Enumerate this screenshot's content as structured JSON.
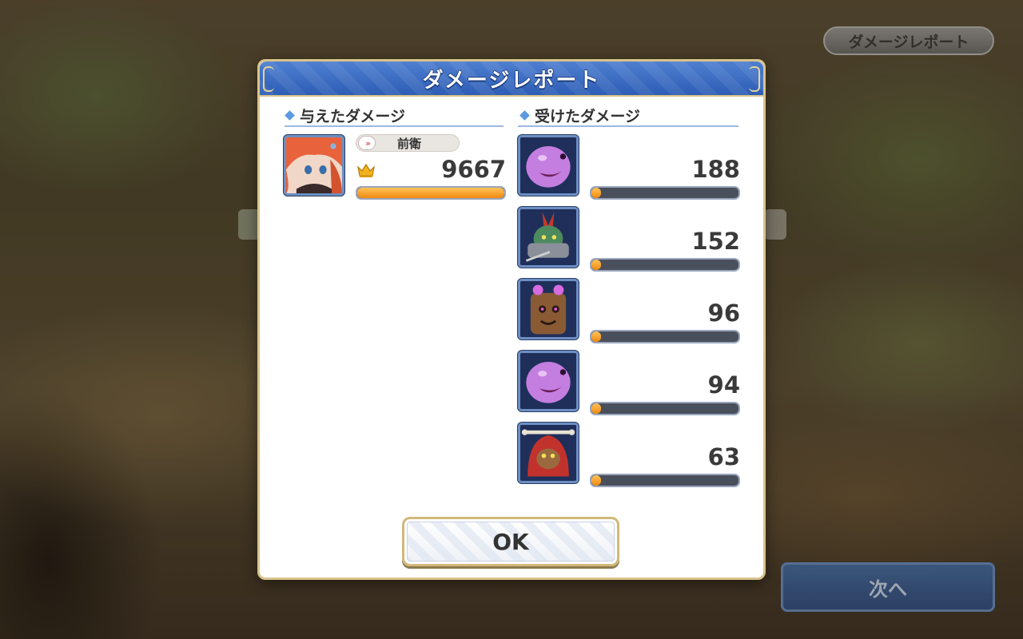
{
  "header_button": {
    "label": "ダメージレポート"
  },
  "next_button": {
    "label": "次へ"
  },
  "dialog": {
    "title": "ダメージレポート",
    "dealt": {
      "title": "与えたダメージ",
      "entries": [
        {
          "role": "前衛",
          "value": "9667",
          "fraction": 1.0,
          "icon": "crown-icon"
        }
      ]
    },
    "received": {
      "title": "受けたダメージ",
      "entries": [
        {
          "value": "188",
          "fraction": 0.02,
          "portrait": "purple-ghost-enemy"
        },
        {
          "value": "152",
          "fraction": 0.02,
          "portrait": "armored-goblin-enemy"
        },
        {
          "value": "96",
          "fraction": 0.01,
          "portrait": "tree-stump-enemy"
        },
        {
          "value": "94",
          "fraction": 0.01,
          "portrait": "purple-ghost-enemy"
        },
        {
          "value": "63",
          "fraction": 0.01,
          "portrait": "red-hood-goblin-enemy"
        }
      ]
    },
    "ok_label": "OK"
  },
  "colors": {
    "header_blue": "#2d5db5",
    "bar_fill": "#f08a10",
    "bar_track": "#4a4f5c",
    "accent_gold": "#d8c48a"
  }
}
